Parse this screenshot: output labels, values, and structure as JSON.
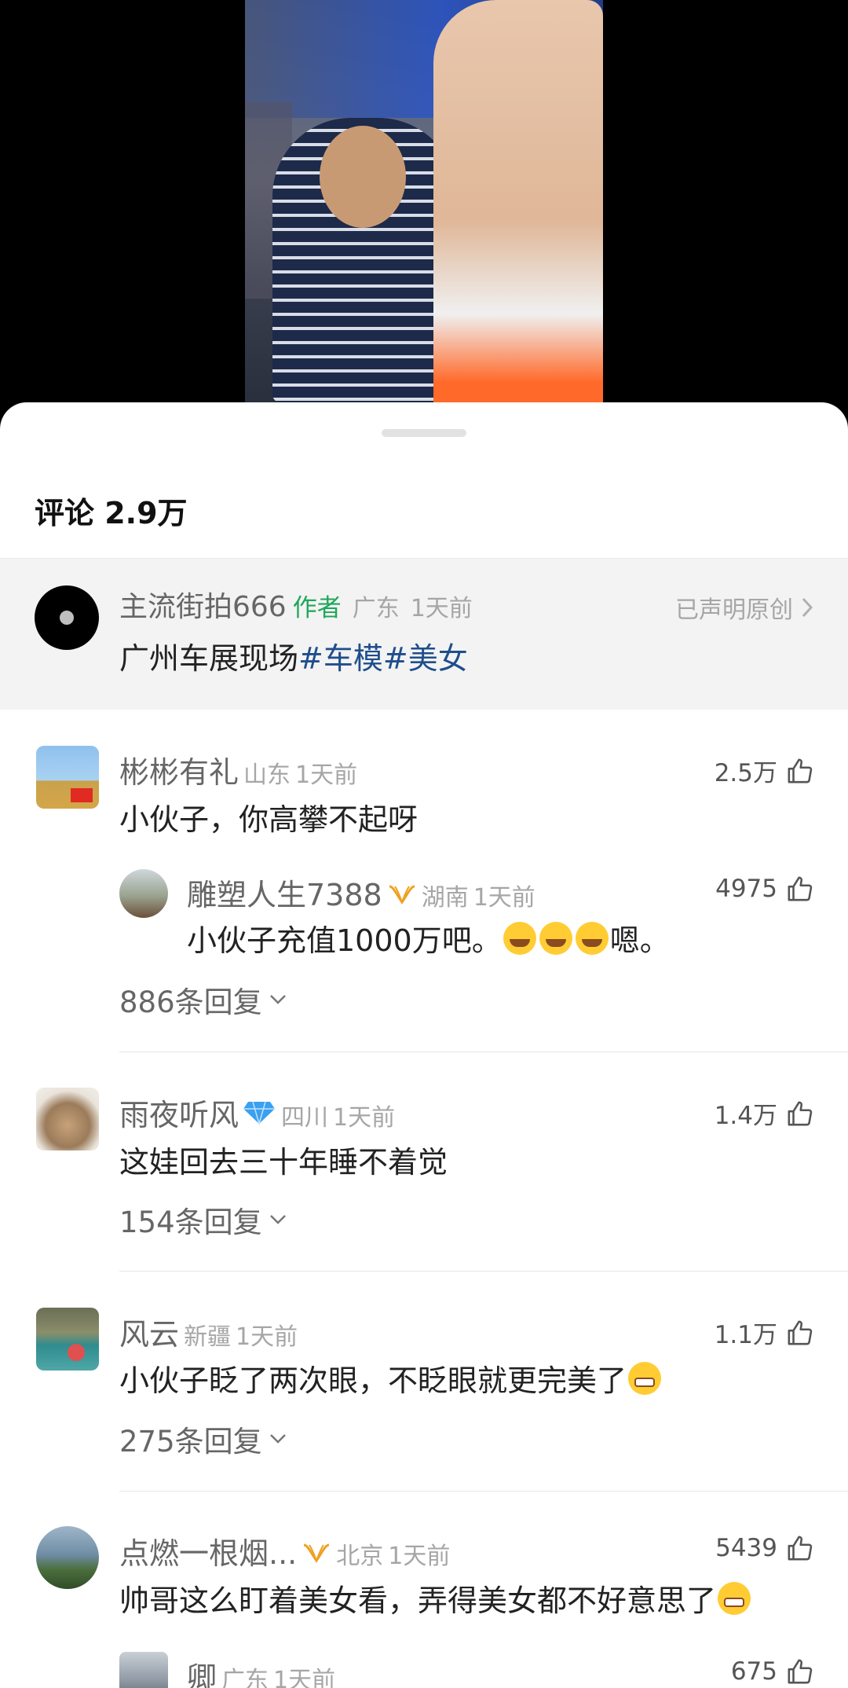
{
  "comments_header": {
    "title": "评论 2.9万"
  },
  "author_post": {
    "username": "主流街拍666",
    "tag": "作者",
    "location": "广东",
    "time": "1天前",
    "original_label": "已声明原创",
    "text_plain": "广州车展现场",
    "hashtags": [
      "#车模",
      "#美女"
    ]
  },
  "comments": [
    {
      "username": "彬彬有礼",
      "location": "山东",
      "time": "1天前",
      "text": "小伙子，你高攀不起呀",
      "likes": "2.5万",
      "sub_reply": {
        "username": "雕塑人生7388",
        "location": "湖南",
        "time": "1天前",
        "text": "小伙子充值1000万吧。",
        "text_suffix": "嗯。",
        "likes": "4975"
      },
      "replies_label": "886条回复"
    },
    {
      "username": "雨夜听风",
      "location": "四川",
      "time": "1天前",
      "text": "这娃回去三十年睡不着觉",
      "likes": "1.4万",
      "replies_label": "154条回复"
    },
    {
      "username": "风云",
      "location": "新疆",
      "time": "1天前",
      "text": "小伙子眨了两次眼，不眨眼就更完美了",
      "likes": "1.1万",
      "replies_label": "275条回复"
    },
    {
      "username": "点燃一根烟...",
      "location": "北京",
      "time": "1天前",
      "text": "帅哥这么盯着美女看，弄得美女都不好意思了",
      "likes": "5439",
      "sub_reply": {
        "username": "卿",
        "location": "广东",
        "time": "1天前",
        "likes": "675"
      }
    }
  ],
  "colors": {
    "author_tag": "#1fa75a",
    "hashtag": "#1f4e8c",
    "muted": "#a6a6a6"
  }
}
